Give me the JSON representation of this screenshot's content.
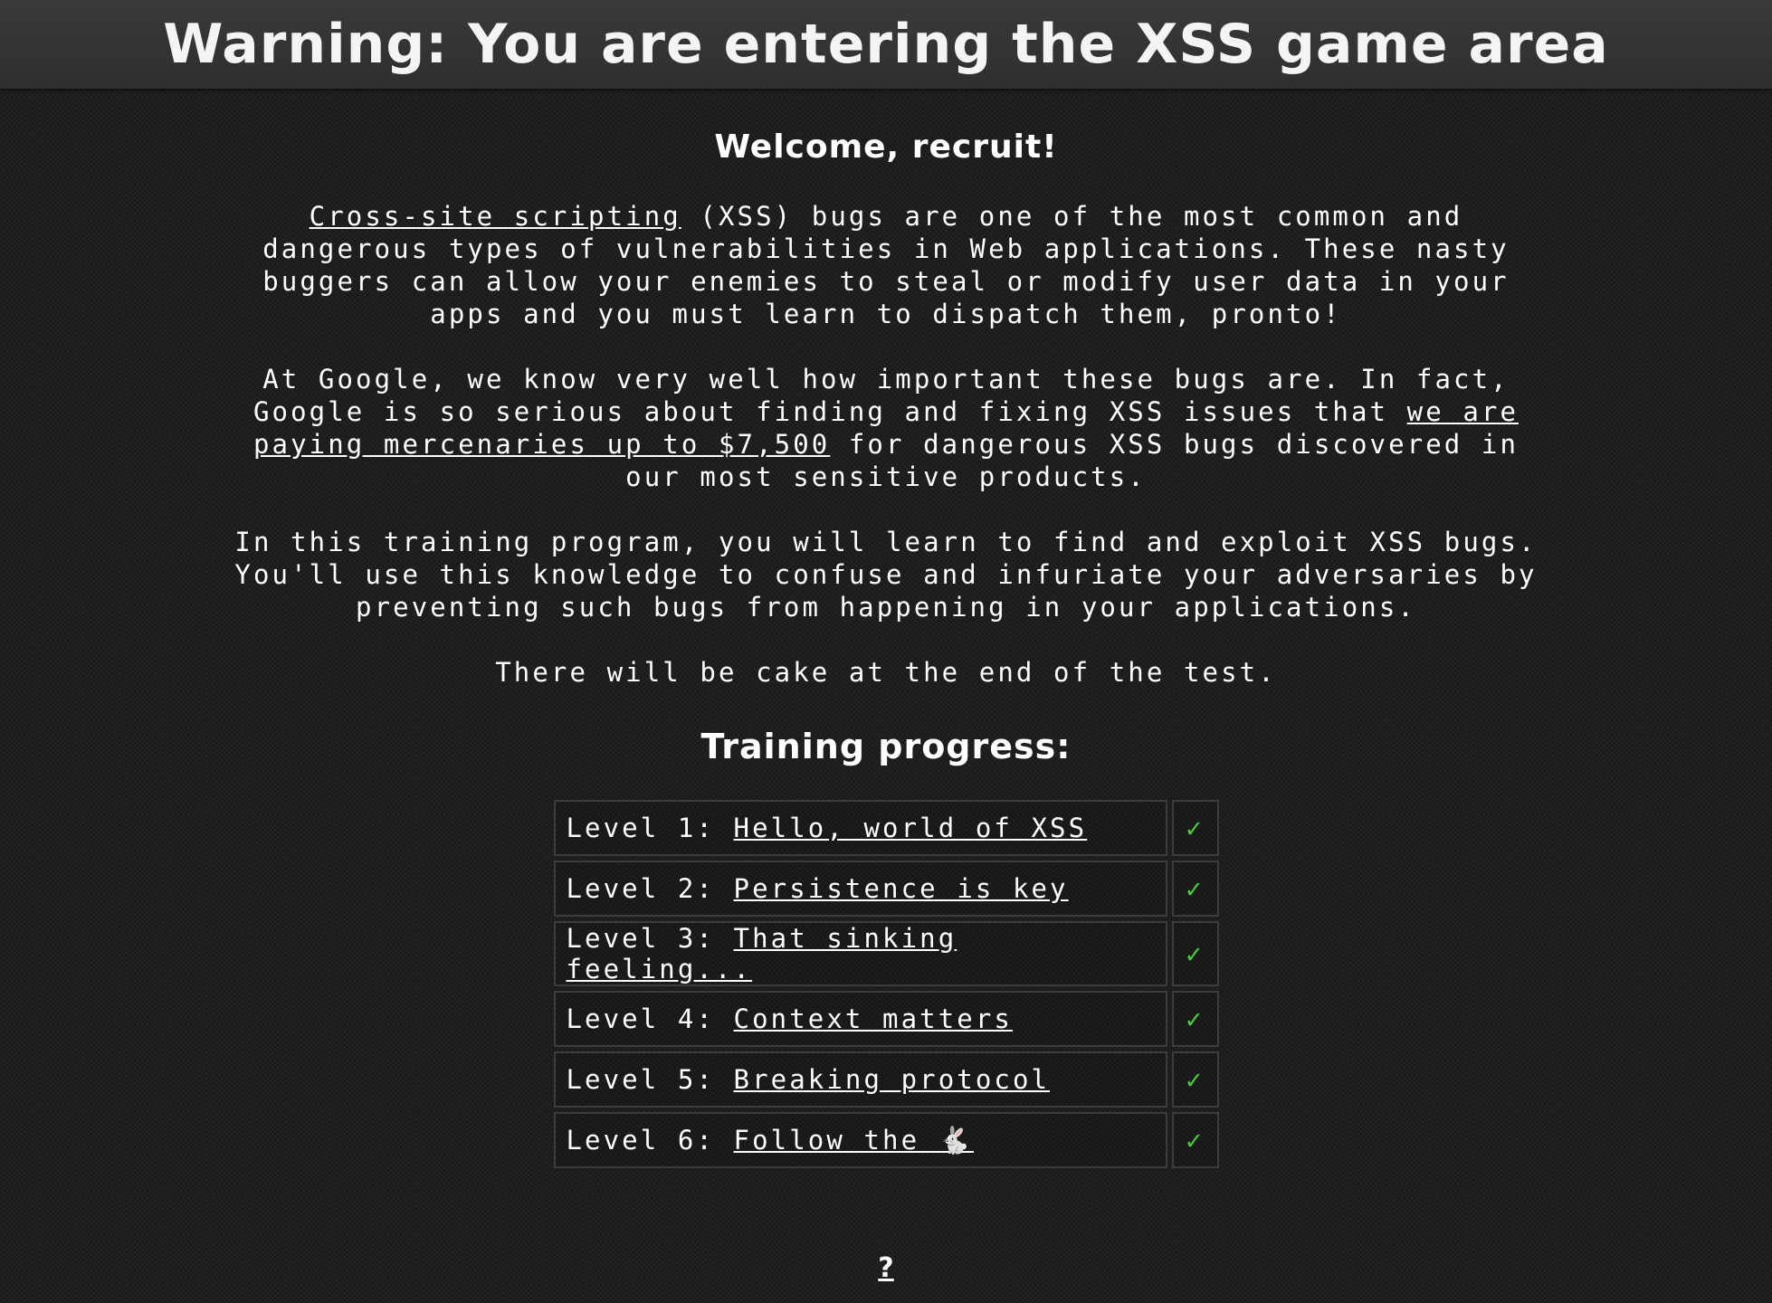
{
  "header": {
    "banner": "Warning: You are entering the XSS game area"
  },
  "intro": {
    "welcome": "Welcome, recruit!",
    "p1_link": "Cross-site scripting",
    "p1_text": " (XSS) bugs are one of the most common and dangerous types of vulnerabilities in Web applications. These nasty buggers can allow your enemies to steal or modify user data in your apps and you must learn to dispatch them, pronto!",
    "p2_before": "At Google, we know very well how important these bugs are. In fact, Google is so serious about finding and fixing XSS issues that ",
    "p2_link": "we are paying mercenaries up to $7,500",
    "p2_after": " for dangerous XSS bugs discovered in our most sensitive products.",
    "p3": "In this training program, you will learn to find and exploit XSS bugs. You'll use this knowledge to confuse and infuriate your adversaries by preventing such bugs from happening in your applications.",
    "p4": "There will be cake at the end of the test."
  },
  "progress": {
    "title": "Training progress:",
    "levels": [
      {
        "label": "Level 1: ",
        "name": "Hello, world of XSS",
        "check": "✓"
      },
      {
        "label": "Level 2: ",
        "name": "Persistence is key",
        "check": "✓"
      },
      {
        "label": "Level 3: ",
        "name": "That sinking feeling...",
        "check": "✓"
      },
      {
        "label": "Level 4: ",
        "name": "Context matters",
        "check": "✓"
      },
      {
        "label": "Level 5: ",
        "name": "Breaking protocol",
        "check": "✓"
      },
      {
        "label": "Level 6: ",
        "name": "Follow the 🐇",
        "check": "✓"
      }
    ],
    "check_color": "#4cc93e"
  },
  "footer": {
    "help_link": "?"
  }
}
